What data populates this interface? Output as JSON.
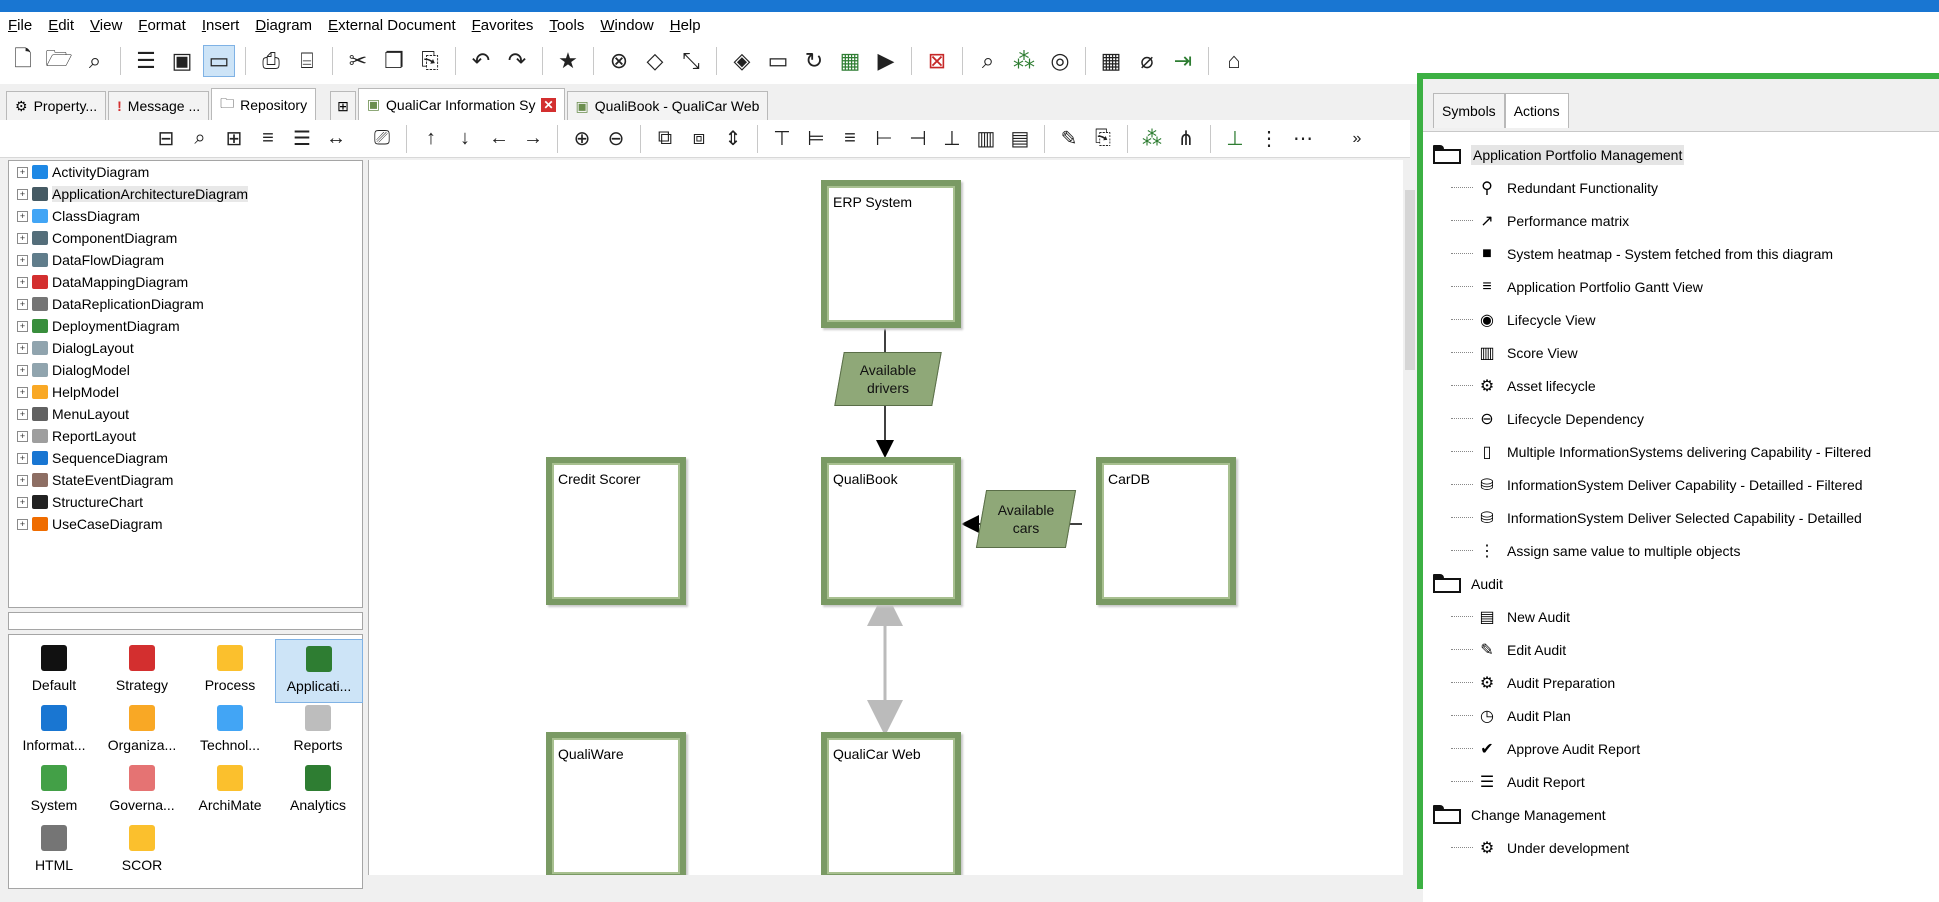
{
  "colors": {
    "accent_bar": "#1976d2",
    "highlight_frame": "#3cb043",
    "box_border": "#7a9a64",
    "flow_fill": "#8fa878"
  },
  "menu": [
    "File",
    "Edit",
    "View",
    "Format",
    "Insert",
    "Diagram",
    "External Document",
    "Favorites",
    "Tools",
    "Window",
    "Help"
  ],
  "toolbar_main_icons": [
    "new-document",
    "open-folder",
    "find-people",
    "list-properties",
    "present",
    "screen",
    "print",
    "print-preview",
    "cut",
    "copy",
    "paste-special",
    "undo",
    "redo",
    "favorite-star",
    "delete-shape",
    "shape-new",
    "resize",
    "fill-bucket",
    "rectangle",
    "rotate",
    "image",
    "play",
    "close-window",
    "search-tree",
    "network",
    "vault",
    "grid",
    "attach",
    "import",
    "html-export"
  ],
  "tabs_left": [
    {
      "label": "Property...",
      "icon": "property-icon"
    },
    {
      "label": "Message ...",
      "icon": "message-icon"
    },
    {
      "label": "Repository",
      "icon": "repository-icon",
      "active": true
    }
  ],
  "doc_tabs": [
    {
      "label": "QualiCar Information Sy"
    },
    {
      "label": "QualiBook - QualiCar Web"
    }
  ],
  "tree": {
    "items": [
      "ActivityDiagram",
      "ApplicationArchitectureDiagram",
      "ClassDiagram",
      "ComponentDiagram",
      "DataFlowDiagram",
      "DataMappingDiagram",
      "DataReplicationDiagram",
      "DeploymentDiagram",
      "DialogLayout",
      "DialogModel",
      "HelpModel",
      "MenuLayout",
      "ReportLayout",
      "SequenceDiagram",
      "StateEventDiagram",
      "StructureChart",
      "UseCaseDiagram"
    ],
    "selected_index": 1
  },
  "palette": {
    "items": [
      {
        "label": "Default",
        "icon": "folder-icon"
      },
      {
        "label": "Strategy",
        "icon": "arrow-up-icon"
      },
      {
        "label": "Process",
        "icon": "process-icon"
      },
      {
        "label": "Applicati...",
        "icon": "application-icon",
        "selected": true
      },
      {
        "label": "Informat...",
        "icon": "information-icon"
      },
      {
        "label": "Organiza...",
        "icon": "organization-icon"
      },
      {
        "label": "Technol...",
        "icon": "technology-icon"
      },
      {
        "label": "Reports",
        "icon": "reports-icon"
      },
      {
        "label": "System",
        "icon": "system-icon"
      },
      {
        "label": "Governa...",
        "icon": "governance-icon"
      },
      {
        "label": "ArchiMate",
        "icon": "archimate-icon"
      },
      {
        "label": "Analytics",
        "icon": "analytics-icon"
      },
      {
        "label": "HTML",
        "icon": "html-icon"
      },
      {
        "label": "SCOR",
        "icon": "scor-icon"
      }
    ]
  },
  "diagram": {
    "boxes": {
      "erp": "ERP System",
      "credit": "Credit Scorer",
      "qualibook": "QualiBook",
      "cardb": "CarDB",
      "qualiware": "QualiWare",
      "qualicar_web": "QualiCar Web"
    },
    "flows": {
      "drivers": "Available drivers",
      "cars": "Available cars"
    }
  },
  "right_panel": {
    "tabs": [
      {
        "label": "Symbols"
      },
      {
        "label": "Actions",
        "active": true
      }
    ],
    "groups": [
      {
        "label": "Application Portfolio Management",
        "items": [
          {
            "label": "Redundant Functionality",
            "icon": "redundant-icon"
          },
          {
            "label": "Performance matrix",
            "icon": "performance-icon"
          },
          {
            "label": "System heatmap - System fetched from this diagram",
            "icon": "heatmap-icon"
          },
          {
            "label": "Application Portfolio Gantt View",
            "icon": "gantt-icon"
          },
          {
            "label": "Lifecycle View",
            "icon": "eye-icon"
          },
          {
            "label": "Score View",
            "icon": "score-icon"
          },
          {
            "label": "Asset lifecycle",
            "icon": "gear-icon"
          },
          {
            "label": "Lifecycle Dependency",
            "icon": "dependency-icon"
          },
          {
            "label": "Multiple InformationSystems delivering Capability - Filtered",
            "icon": "page-icon"
          },
          {
            "label": "InformationSystem Deliver Capability - Detailled - Filtered",
            "icon": "database-filter-icon"
          },
          {
            "label": "InformationSystem Deliver Selected Capability - Detailled",
            "icon": "database-list-icon"
          },
          {
            "label": "Assign same value to multiple objects",
            "icon": "assign-icon"
          }
        ]
      },
      {
        "label": "Audit",
        "items": [
          {
            "label": "New Audit",
            "icon": "new-audit-icon"
          },
          {
            "label": "Edit Audit",
            "icon": "edit-audit-icon"
          },
          {
            "label": "Audit Preparation",
            "icon": "audit-prep-icon"
          },
          {
            "label": "Audit Plan",
            "icon": "audit-plan-icon"
          },
          {
            "label": "Approve Audit Report",
            "icon": "approve-icon"
          },
          {
            "label": "Audit Report",
            "icon": "audit-report-icon"
          }
        ]
      },
      {
        "label": "Change Management",
        "items": [
          {
            "label": "Under development",
            "icon": "under-dev-icon"
          }
        ]
      }
    ]
  }
}
